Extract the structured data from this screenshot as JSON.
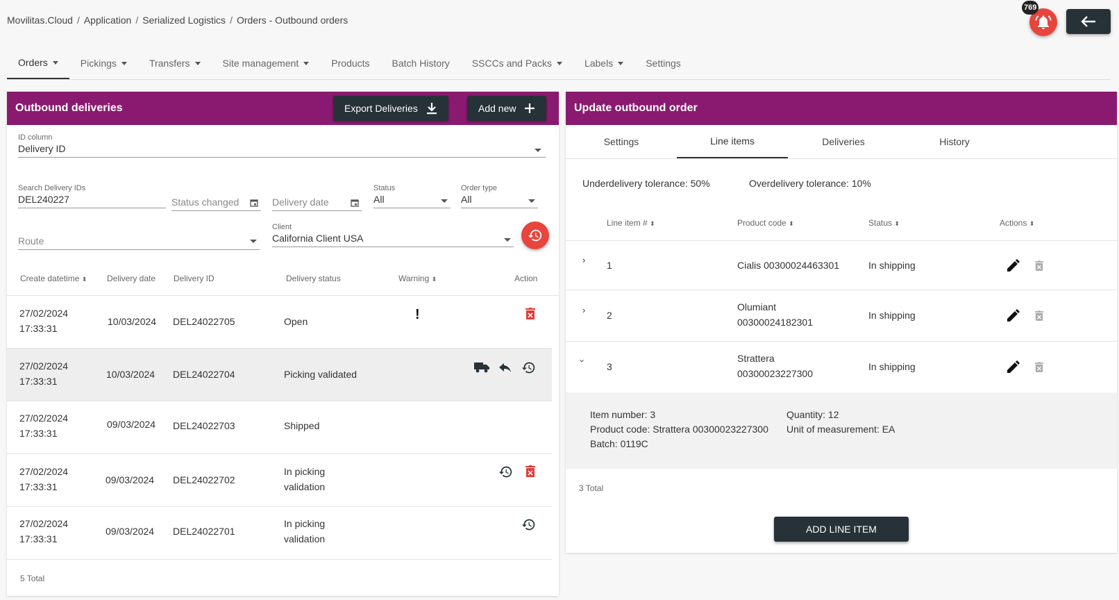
{
  "breadcrumb": [
    "Movilitas.Cloud",
    "Application",
    "Serialized Logistics",
    "Orders - Outbound orders"
  ],
  "notifications": {
    "count": "769"
  },
  "nav": [
    {
      "label": "Orders",
      "dropdown": true,
      "active": true
    },
    {
      "label": "Pickings",
      "dropdown": true
    },
    {
      "label": "Transfers",
      "dropdown": true
    },
    {
      "label": "Site management",
      "dropdown": true
    },
    {
      "label": "Products",
      "dropdown": false
    },
    {
      "label": "Batch History",
      "dropdown": false
    },
    {
      "label": "SSCCs and Packs",
      "dropdown": true
    },
    {
      "label": "Labels",
      "dropdown": true
    },
    {
      "label": "Settings",
      "dropdown": false
    }
  ],
  "left": {
    "title": "Outbound deliveries",
    "export_label": "Export Deliveries",
    "add_label": "Add new",
    "id_column": {
      "label": "ID column",
      "value": "Delivery ID"
    },
    "search": {
      "label": "Search Delivery IDs",
      "value": "DEL240227"
    },
    "status_changed_ph": "Status changed",
    "delivery_date_ph": "Delivery date",
    "status": {
      "label": "Status",
      "value": "All"
    },
    "order_type": {
      "label": "Order type",
      "value": "All"
    },
    "route_ph": "Route",
    "client": {
      "label": "Client",
      "value": "California Client USA"
    },
    "columns": [
      "Create datetime",
      "Delivery date",
      "Delivery ID",
      "Delivery status",
      "Warning",
      "Action"
    ],
    "rows": [
      {
        "create_date": "27/02/2024",
        "create_time": "17:33:31",
        "delivery_date": "10/03/2024",
        "id": "DEL24022705",
        "status1": "Open",
        "status2": ""
      },
      {
        "create_date": "27/02/2024",
        "create_time": "17:33:31",
        "delivery_date": "10/03/2024",
        "id": "DEL24022704",
        "status1": "Picking validated",
        "status2": ""
      },
      {
        "create_date": "27/02/2024",
        "create_time": "17:33:31",
        "delivery_date": "09/03/2024",
        "id": "DEL24022703",
        "status1": "Shipped",
        "status2": ""
      },
      {
        "create_date": "27/02/2024",
        "create_time": "17:33:31",
        "delivery_date": "09/03/2024",
        "id": "DEL24022702",
        "status1": "In picking",
        "status2": "validation"
      },
      {
        "create_date": "27/02/2024",
        "create_time": "17:33:31",
        "delivery_date": "09/03/2024",
        "id": "DEL24022701",
        "status1": "In picking",
        "status2": "validation"
      }
    ],
    "total": "5 Total"
  },
  "right": {
    "title": "Update outbound order",
    "tabs": [
      "Settings",
      "Line items",
      "Deliveries",
      "History"
    ],
    "under_tol": "Underdelivery tolerance: 50%",
    "over_tol": "Overdelivery tolerance: 10%",
    "columns": [
      "Line item #",
      "Product code",
      "Status",
      "Actions"
    ],
    "rows": [
      {
        "num": "1",
        "prod1": "Cialis 00300024463301",
        "prod2": "",
        "status": "In shipping"
      },
      {
        "num": "2",
        "prod1": "Olumiant",
        "prod2": "00300024182301",
        "status": "In shipping"
      },
      {
        "num": "3",
        "prod1": "Strattera",
        "prod2": "00300023227300",
        "status": "In shipping"
      }
    ],
    "detail": {
      "item_number": "Item number: 3",
      "product_code": "Product code: Strattera 00300023227300",
      "batch": "Batch: 0119C",
      "quantity": "Quantity: 12",
      "uom": "Unit of measurement: EA"
    },
    "total": "3 Total",
    "add_line_label": "ADD LINE ITEM"
  },
  "colors": {
    "header": "#8a1a70",
    "dark": "#263238",
    "danger": "#e53935",
    "notif": "#e8453c"
  }
}
